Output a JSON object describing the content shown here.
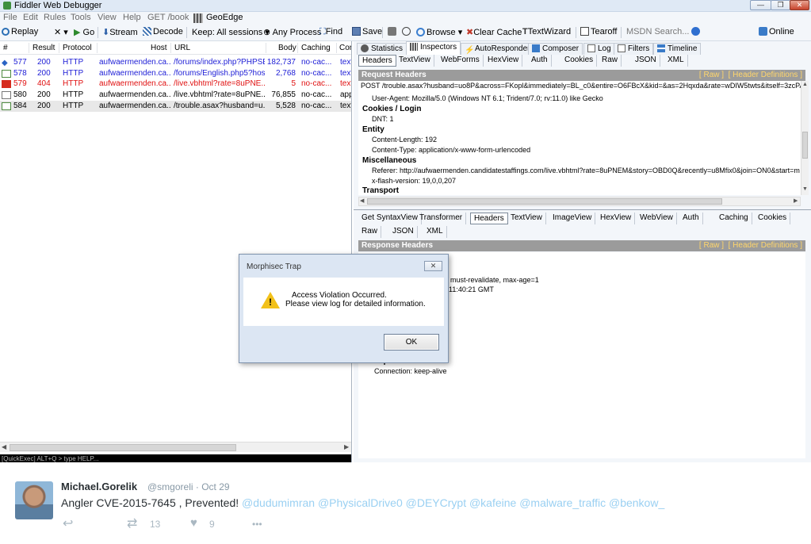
{
  "window": {
    "title": "Fiddler Web Debugger",
    "min_glyph": "—",
    "max_glyph": "❐",
    "close_glyph": "✕"
  },
  "menu": {
    "items": [
      "File",
      "Edit",
      "Rules",
      "Tools",
      "View",
      "Help",
      "GET /book",
      "GeoEdge"
    ]
  },
  "toolbar": {
    "replay": "Replay",
    "remove": "✕ ▾",
    "go": "Go",
    "stream": "Stream",
    "decode": "Decode",
    "keep": "Keep: All sessions ▾",
    "process": "Any Process",
    "find": "Find",
    "save": "Save",
    "browse": "Browse ▾",
    "clear_cache": "Clear Cache",
    "textwizard": "TextWizard",
    "tearoff": "Tearoff",
    "msdn_search": "MSDN Search...",
    "online": "Online",
    "icons": [
      "replay-icon",
      "remove-icon",
      "go-icon",
      "stream-icon",
      "decode-icon",
      "target-icon",
      "find-icon",
      "save-icon",
      "camera-icon",
      "timer-icon",
      "browse-icon",
      "clear-cache-icon",
      "textwizard-icon",
      "tearoff-icon",
      "help-icon",
      "online-icon"
    ]
  },
  "sessions": {
    "columns": [
      "#",
      "Result",
      "Protocol",
      "Host",
      "URL",
      "Body",
      "Caching",
      "Con"
    ],
    "rows": [
      {
        "id": "577",
        "result": "200",
        "protocol": "HTTP",
        "host": "aufwaermenden.ca...",
        "url": "/forums/index.php?PHPSE...",
        "body": "182,737",
        "caching": "no-cac...",
        "content": "text",
        "color": "#1d1dd6",
        "icon": "arrows-icon"
      },
      {
        "id": "578",
        "result": "200",
        "protocol": "HTTP",
        "host": "aufwaermenden.ca...",
        "url": "/forums/English.php5?hos...",
        "body": "2,768",
        "caching": "no-cac...",
        "content": "text",
        "color": "#1d1dd6",
        "icon": "page-icon"
      },
      {
        "id": "579",
        "result": "404",
        "protocol": "HTTP",
        "host": "aufwaermenden.ca...",
        "url": "/live.vbhtml?rate=8uPNE...",
        "body": "5",
        "caching": "no-cac...",
        "content": "text",
        "color": "#e01010",
        "icon": "warning-icon"
      },
      {
        "id": "580",
        "result": "200",
        "protocol": "HTTP",
        "host": "aufwaermenden.ca...",
        "url": "/live.vbhtml?rate=8uPNE...",
        "body": "76,855",
        "caching": "no-cac...",
        "content": "app",
        "color": "#000000",
        "icon": "document-icon"
      },
      {
        "id": "584",
        "result": "200",
        "protocol": "HTTP",
        "host": "aufwaermenden.ca...",
        "url": "/trouble.asax?husband=u...",
        "body": "5,528",
        "caching": "no-cac...",
        "content": "text",
        "color": "#000000",
        "icon": "page-icon",
        "selected": true
      }
    ],
    "quickexec": "[QuickExec] ALT+Q > type HELP..."
  },
  "inspectors": {
    "tabs": [
      "Statistics",
      "Inspectors",
      "AutoResponder",
      "Composer",
      "Log",
      "Filters",
      "Timeline"
    ],
    "active_tab": "Inspectors",
    "request_tabs": [
      "Headers",
      "TextView",
      "WebForms",
      "HexView",
      "Auth",
      "Cookies",
      "Raw",
      "JSON",
      "XML"
    ],
    "request_header_title": "Request Headers",
    "raw_link": "[ Raw ]",
    "defs_link": "[ Header Definitions ]",
    "request_line": "POST /trouble.asax?husband=uo8P&across=FKopl&immediately=BL_c0&entire=O6FBcX&kid=&as=2Hqxda&rate=wDIW5twts&itself=3zcPA&woman=",
    "request_lines": [
      {
        "text": "User-Agent: Mozilla/5.0 (Windows NT 6.1; Trident/7.0; rv:11.0) like Gecko",
        "group": false
      },
      {
        "text": "Cookies / Login",
        "group": true
      },
      {
        "text": "DNT: 1",
        "group": false
      },
      {
        "text": "Entity",
        "group": true
      },
      {
        "text": "Content-Length: 192",
        "group": false
      },
      {
        "text": "Content-Type: application/x-www-form-urlencoded",
        "group": false
      },
      {
        "text": "Miscellaneous",
        "group": true
      },
      {
        "text": "Referer: http://aufwaermenden.candidatestaffings.com/live.vbhtml?rate=8uPNEM&story=OBD0Q&recently=u8Mfix0&join=ON0&start=m",
        "group": false
      },
      {
        "text": "x-flash-version: 19,0,0,207",
        "group": false
      },
      {
        "text": "Transport",
        "group": true
      }
    ],
    "response_tabs_row1": [
      "Get SyntaxView",
      "Transformer",
      "Headers",
      "TextView",
      "ImageView",
      "HexView",
      "WebView",
      "Auth",
      "Caching",
      "Cookies"
    ],
    "response_tabs_row2": [
      "Raw",
      "JSON",
      "XML"
    ],
    "response_active_tab": "Headers",
    "response_header_title": "Response Headers",
    "response_lines": [
      {
        "text": "e, must-revalidate, max-age=1",
        "group": false
      },
      {
        "text": "11:40:21 GMT",
        "group": false
      },
      {
        "text": "Transport",
        "group": true
      },
      {
        "text": "Connection: keep-alive",
        "group": false
      }
    ]
  },
  "dialog": {
    "title": "Morphisec Trap",
    "close": "✕",
    "message_line1": "Access Violation Occurred.",
    "message_line2": "Please view log for detailed information.",
    "ok": "OK",
    "icon": "warning-icon"
  },
  "tweet": {
    "name": "Michael.Gorelik",
    "handle": "@smgoreli · Oct 29",
    "text": "Angler CVE-2015-7645 , Prevented!",
    "mentions": "@dudumimran @PhysicalDrive0 @DEYCrypt @kafeine @malware_traffic @benkow_",
    "reply_glyph": "↩",
    "retweet_glyph": "⇄",
    "retweet_count": "13",
    "like_glyph": "♥",
    "like_count": "9",
    "more_glyph": "•••"
  },
  "colors": {
    "http_blue": "#1d1dd6",
    "error_red": "#e01010",
    "section_gray": "#9b9b9b",
    "link_yellow": "#ffd66b",
    "mention_blue": "#9ad0f2"
  }
}
